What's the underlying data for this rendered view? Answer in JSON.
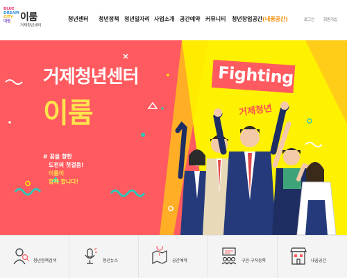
{
  "logo": {
    "line1": "BLUE",
    "line2": "DREAM",
    "line3": "CITY",
    "line4": "대청",
    "name": "이룸",
    "sub": "거제청년센터"
  },
  "nav": {
    "items": [
      {
        "label": "청년센터"
      },
      {
        "label": "청년정책"
      },
      {
        "label": "청년일자리"
      },
      {
        "label": "사업소개"
      },
      {
        "label": "공간예약"
      },
      {
        "label": "커뮤니티"
      }
    ],
    "last_label": "청년창업공간",
    "last_accent": "(내꿈공간)"
  },
  "util": {
    "login": "로그인",
    "join": "회원가입"
  },
  "hero": {
    "title": "거제청년센터",
    "name": "이룸",
    "copy_line1": "# 꿈을 향한",
    "copy_line2": "도전의 첫걸음!",
    "copy_line3": "이룸이",
    "copy_line4": "함께 합니다!",
    "banner": "Fighting",
    "banner_sub": "거제청년",
    "colors": {
      "background": "#ff5a5f",
      "highlight": "#ffe34d",
      "spotlight": "#fff200"
    }
  },
  "quick_menu": [
    {
      "label": "청년정책검색",
      "icon": "person-search-icon"
    },
    {
      "label": "청년뉴스",
      "icon": "news-microphone-icon"
    },
    {
      "label": "공간예약",
      "icon": "map-pin-icon"
    },
    {
      "label": "구인·구직등록",
      "icon": "job-board-icon"
    },
    {
      "label": "내꿈공간",
      "icon": "building-icon"
    }
  ]
}
